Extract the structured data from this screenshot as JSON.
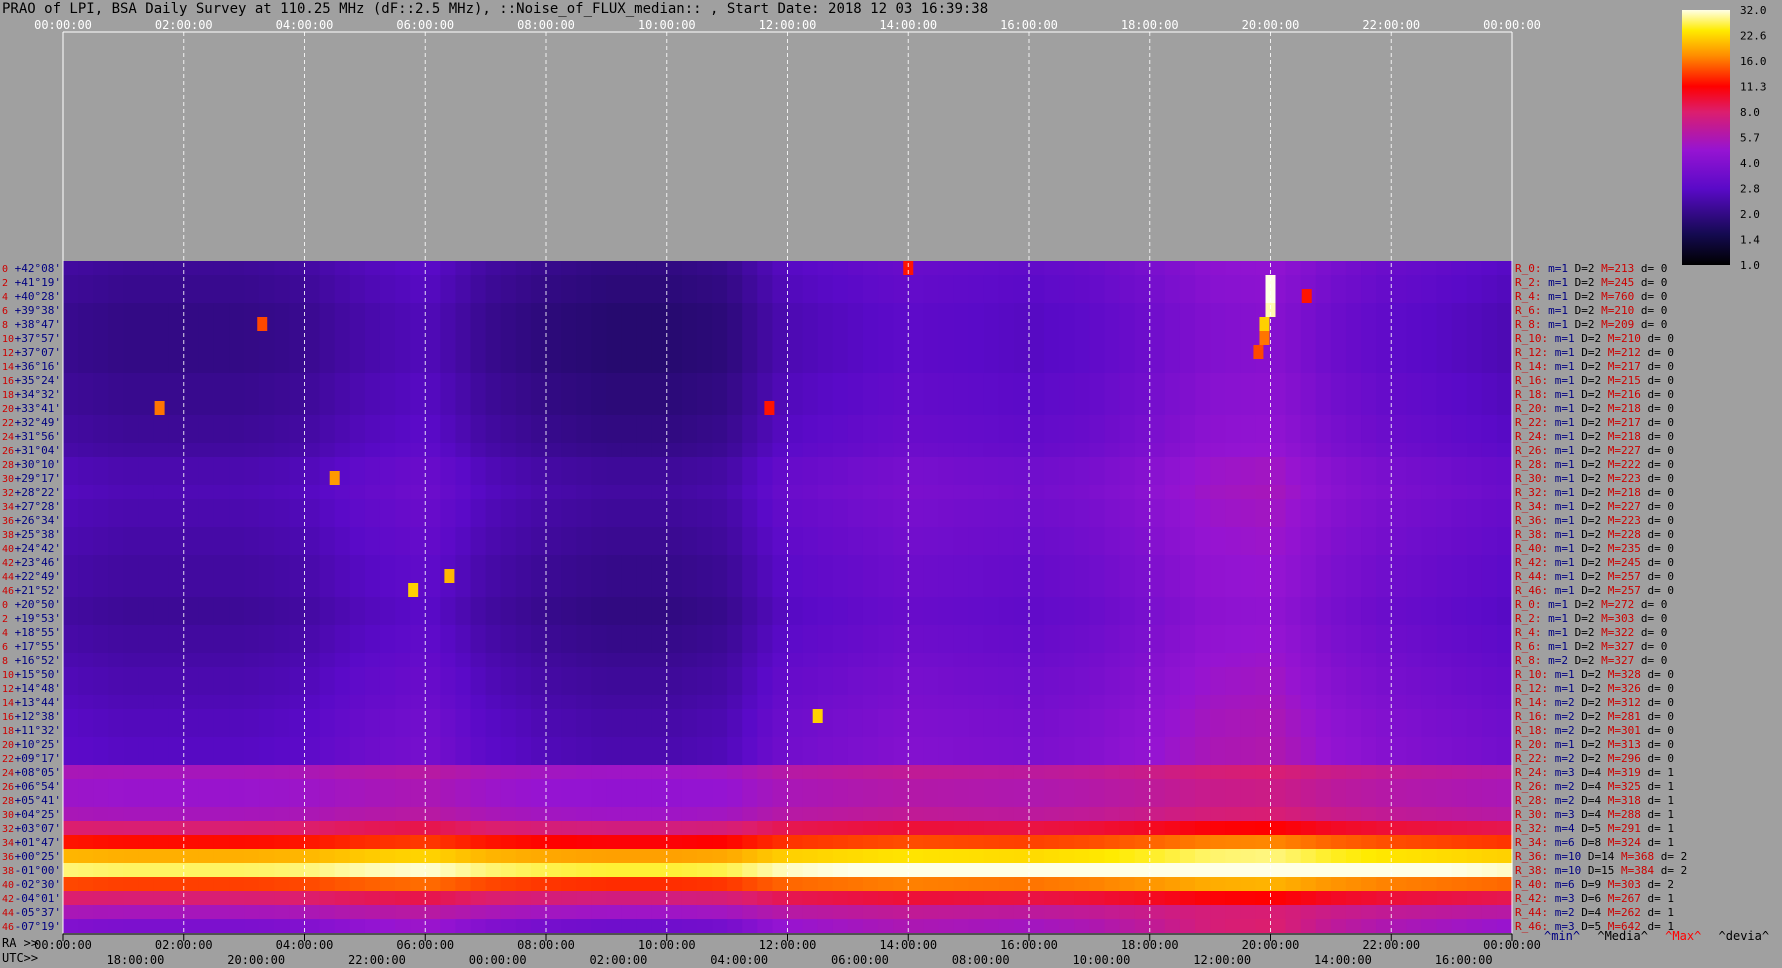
{
  "title": "PRAO of LPI, BSA Daily Survey at 110.25 MHz (dF::2.5 MHz), ::Noise_of_FLUX_median:: , Start Date: 2018 12 03 16:39:38",
  "colors": {
    "background": "#a0a0a0",
    "top_axis_text": "#ffffff",
    "row_index": "#cc0000",
    "dec_label": "#000080",
    "stat_red": "#cc0000",
    "stat_blue": "#000080"
  },
  "chart_data": {
    "type": "heatmap",
    "title": "PRAO of LPI, BSA Daily Survey at 110.25 MHz (dF::2.5 MHz), ::Noise_of_FLUX_median:: , Start Date: 2018 12 03 16:39:38",
    "top_time_ticks": [
      "00:00:00",
      "02:00:00",
      "04:00:00",
      "06:00:00",
      "08:00:00",
      "10:00:00",
      "12:00:00",
      "14:00:00",
      "16:00:00",
      "18:00:00",
      "20:00:00",
      "22:00:00",
      "00:00:00"
    ],
    "ra_label": "RA >>",
    "ra_ticks": [
      "00:00:00",
      "02:00:00",
      "04:00:00",
      "06:00:00",
      "08:00:00",
      "10:00:00",
      "12:00:00",
      "14:00:00",
      "16:00:00",
      "18:00:00",
      "20:00:00",
      "22:00:00",
      "00:00:00"
    ],
    "utc_label": "UTC>>",
    "utc_ticks": [
      "18:00:00",
      "20:00:00",
      "22:00:00",
      "00:00:00",
      "02:00:00",
      "04:00:00",
      "06:00:00",
      "08:00:00",
      "10:00:00",
      "12:00:00",
      "14:00:00",
      "16:00:00"
    ],
    "colorbar": {
      "ticks": [
        "32.0",
        "22.6",
        "16.0",
        "11.3",
        "8.0",
        "5.7",
        "4.0",
        "2.8",
        "2.0",
        "1.4",
        "1.0"
      ],
      "range": [
        1.0,
        32.0
      ],
      "scale": "log"
    },
    "row_indices": [
      "0",
      "2",
      "4",
      "6",
      "8",
      "10",
      "12",
      "14",
      "16",
      "18",
      "20",
      "22",
      "24",
      "26",
      "28",
      "30",
      "32",
      "34",
      "36",
      "38",
      "40",
      "42",
      "44",
      "46",
      "0",
      "2",
      "4",
      "6",
      "8",
      "10",
      "12",
      "14",
      "16",
      "18",
      "20",
      "22",
      "24",
      "26",
      "28",
      "30",
      "32",
      "34",
      "36",
      "38",
      "40",
      "42",
      "44",
      "46"
    ],
    "declinations": [
      "+42°08'",
      "+41°19'",
      "+40°28'",
      "+39°38'",
      "+38°47'",
      "+37°57'",
      "+37°07'",
      "+36°16'",
      "+35°24'",
      "+34°32'",
      "+33°41'",
      "+32°49'",
      "+31°56'",
      "+31°04'",
      "+30°10'",
      "+29°17'",
      "+28°22'",
      "+27°28'",
      "+26°34'",
      "+25°38'",
      "+24°42'",
      "+23°46'",
      "+22°49'",
      "+21°52'",
      "+20°50'",
      "+19°53'",
      "+18°55'",
      "+17°55'",
      "+16°52'",
      "+15°50'",
      "+14°48'",
      "+13°44'",
      "+12°38'",
      "+11°32'",
      "+10°25'",
      "+09°17'",
      "+08°05'",
      "+06°54'",
      "+05°41'",
      "+04°25'",
      "+03°07'",
      "+01°47'",
      "+00°25'",
      "-01°00'",
      "-02°30'",
      "-04°01'",
      "-05°37'",
      "-07°19'"
    ],
    "row_stats": [
      {
        "r": "R_0:",
        "m": "m=1",
        "D": "D=2",
        "M": "M=213",
        "d": "d= 0"
      },
      {
        "r": "R_2:",
        "m": "m=1",
        "D": "D=2",
        "M": "M=245",
        "d": "d= 0"
      },
      {
        "r": "R_4:",
        "m": "m=1",
        "D": "D=2",
        "M": "M=760",
        "d": "d= 0"
      },
      {
        "r": "R_6:",
        "m": "m=1",
        "D": "D=2",
        "M": "M=210",
        "d": "d= 0"
      },
      {
        "r": "R_8:",
        "m": "m=1",
        "D": "D=2",
        "M": "M=209",
        "d": "d= 0"
      },
      {
        "r": "R_10:",
        "m": "m=1",
        "D": "D=2",
        "M": "M=210",
        "d": "d= 0"
      },
      {
        "r": "R_12:",
        "m": "m=1",
        "D": "D=2",
        "M": "M=212",
        "d": "d= 0"
      },
      {
        "r": "R_14:",
        "m": "m=1",
        "D": "D=2",
        "M": "M=217",
        "d": "d= 0"
      },
      {
        "r": "R_16:",
        "m": "m=1",
        "D": "D=2",
        "M": "M=215",
        "d": "d= 0"
      },
      {
        "r": "R_18:",
        "m": "m=1",
        "D": "D=2",
        "M": "M=216",
        "d": "d= 0"
      },
      {
        "r": "R_20:",
        "m": "m=1",
        "D": "D=2",
        "M": "M=218",
        "d": "d= 0"
      },
      {
        "r": "R_22:",
        "m": "m=1",
        "D": "D=2",
        "M": "M=217",
        "d": "d= 0"
      },
      {
        "r": "R_24:",
        "m": "m=1",
        "D": "D=2",
        "M": "M=218",
        "d": "d= 0"
      },
      {
        "r": "R_26:",
        "m": "m=1",
        "D": "D=2",
        "M": "M=227",
        "d": "d= 0"
      },
      {
        "r": "R_28:",
        "m": "m=1",
        "D": "D=2",
        "M": "M=222",
        "d": "d= 0"
      },
      {
        "r": "R_30:",
        "m": "m=1",
        "D": "D=2",
        "M": "M=223",
        "d": "d= 0"
      },
      {
        "r": "R_32:",
        "m": "m=1",
        "D": "D=2",
        "M": "M=218",
        "d": "d= 0"
      },
      {
        "r": "R_34:",
        "m": "m=1",
        "D": "D=2",
        "M": "M=227",
        "d": "d= 0"
      },
      {
        "r": "R_36:",
        "m": "m=1",
        "D": "D=2",
        "M": "M=223",
        "d": "d= 0"
      },
      {
        "r": "R_38:",
        "m": "m=1",
        "D": "D=2",
        "M": "M=228",
        "d": "d= 0"
      },
      {
        "r": "R_40:",
        "m": "m=1",
        "D": "D=2",
        "M": "M=235",
        "d": "d= 0"
      },
      {
        "r": "R_42:",
        "m": "m=1",
        "D": "D=2",
        "M": "M=245",
        "d": "d= 0"
      },
      {
        "r": "R_44:",
        "m": "m=1",
        "D": "D=2",
        "M": "M=257",
        "d": "d= 0"
      },
      {
        "r": "R_46:",
        "m": "m=1",
        "D": "D=2",
        "M": "M=257",
        "d": "d= 0"
      },
      {
        "r": "R_0:",
        "m": "m=1",
        "D": "D=2",
        "M": "M=272",
        "d": "d= 0"
      },
      {
        "r": "R_2:",
        "m": "m=1",
        "D": "D=2",
        "M": "M=303",
        "d": "d= 0"
      },
      {
        "r": "R_4:",
        "m": "m=1",
        "D": "D=2",
        "M": "M=322",
        "d": "d= 0"
      },
      {
        "r": "R_6:",
        "m": "m=1",
        "D": "D=2",
        "M": "M=327",
        "d": "d= 0"
      },
      {
        "r": "R_8:",
        "m": "m=2",
        "D": "D=2",
        "M": "M=327",
        "d": "d= 0"
      },
      {
        "r": "R_10:",
        "m": "m=1",
        "D": "D=2",
        "M": "M=328",
        "d": "d= 0"
      },
      {
        "r": "R_12:",
        "m": "m=1",
        "D": "D=2",
        "M": "M=326",
        "d": "d= 0"
      },
      {
        "r": "R_14:",
        "m": "m=2",
        "D": "D=2",
        "M": "M=312",
        "d": "d= 0"
      },
      {
        "r": "R_16:",
        "m": "m=2",
        "D": "D=2",
        "M": "M=281",
        "d": "d= 0"
      },
      {
        "r": "R_18:",
        "m": "m=2",
        "D": "D=2",
        "M": "M=301",
        "d": "d= 0"
      },
      {
        "r": "R_20:",
        "m": "m=1",
        "D": "D=2",
        "M": "M=313",
        "d": "d= 0"
      },
      {
        "r": "R_22:",
        "m": "m=2",
        "D": "D=2",
        "M": "M=296",
        "d": "d= 0"
      },
      {
        "r": "R_24:",
        "m": "m=3",
        "D": "D=4",
        "M": "M=319",
        "d": "d= 1"
      },
      {
        "r": "R_26:",
        "m": "m=2",
        "D": "D=4",
        "M": "M=325",
        "d": "d= 1"
      },
      {
        "r": "R_28:",
        "m": "m=2",
        "D": "D=4",
        "M": "M=318",
        "d": "d= 1"
      },
      {
        "r": "R_30:",
        "m": "m=3",
        "D": "D=4",
        "M": "M=288",
        "d": "d= 1"
      },
      {
        "r": "R_32:",
        "m": "m=4",
        "D": "D=5",
        "M": "M=291",
        "d": "d= 1"
      },
      {
        "r": "R_34:",
        "m": "m=6",
        "D": "D=8",
        "M": "M=324",
        "d": "d= 1"
      },
      {
        "r": "R_36:",
        "m": "m=10",
        "D": "D=14",
        "M": "M=368",
        "d": "d= 2"
      },
      {
        "r": "R_38:",
        "m": "m=10",
        "D": "D=15",
        "M": "M=384",
        "d": "d= 2"
      },
      {
        "r": "R_40:",
        "m": "m=6",
        "D": "D=9",
        "M": "M=303",
        "d": "d= 2"
      },
      {
        "r": "R_42:",
        "m": "m=3",
        "D": "D=6",
        "M": "M=267",
        "d": "d= 1"
      },
      {
        "r": "R_44:",
        "m": "m=2",
        "D": "D=4",
        "M": "M=262",
        "d": "d= 1"
      },
      {
        "r": "R_46:",
        "m": "m=3",
        "D": "D=5",
        "M": "M=642",
        "d": "d= 1"
      }
    ],
    "stat_legend": {
      "min": "^min^",
      "median": "^Media^",
      "max": "^Max^",
      "dev": "^devia^"
    },
    "row_levels": [
      2.3,
      2.2,
      2.2,
      2.1,
      2.1,
      2.1,
      2.1,
      2.1,
      2.2,
      2.2,
      2.2,
      2.3,
      2.3,
      2.4,
      2.6,
      2.6,
      2.7,
      2.6,
      2.6,
      2.5,
      2.5,
      2.4,
      2.4,
      2.4,
      2.3,
      2.3,
      2.4,
      2.4,
      2.5,
      2.6,
      2.6,
      2.7,
      2.8,
      2.8,
      2.9,
      2.9,
      5.5,
      5.0,
      5.0,
      5.5,
      8.0,
      12.0,
      20.0,
      28.0,
      14.0,
      8.0,
      5.5,
      4.0
    ],
    "time_profile": {
      "hours": [
        0,
        1,
        2,
        3,
        4,
        5,
        6,
        7,
        8,
        9,
        10,
        11,
        12,
        13,
        14,
        15,
        16,
        17,
        18,
        19,
        20,
        21,
        22,
        23,
        24
      ],
      "factor": [
        1.0,
        0.95,
        0.95,
        0.95,
        1.0,
        1.15,
        1.25,
        1.0,
        0.9,
        0.85,
        0.85,
        0.9,
        1.2,
        1.3,
        1.4,
        1.35,
        1.3,
        1.4,
        1.6,
        1.9,
        2.0,
        1.6,
        1.4,
        1.3,
        1.2
      ]
    },
    "hotspots": [
      {
        "hour": 20.0,
        "dec": "+40°28'",
        "value": 32.0
      },
      {
        "hour": 20.0,
        "dec": "+41°19'",
        "value": 32.0
      },
      {
        "hour": 20.0,
        "dec": "+39°38'",
        "value": 30.0
      },
      {
        "hour": 19.9,
        "dec": "+38°47'",
        "value": 22.0
      },
      {
        "hour": 19.9,
        "dec": "+37°57'",
        "value": 16.0
      },
      {
        "hour": 19.8,
        "dec": "+37°07'",
        "value": 14.0
      },
      {
        "hour": 5.8,
        "dec": "+21°52'",
        "value": 22.0
      },
      {
        "hour": 6.4,
        "dec": "+22°49'",
        "value": 20.0
      },
      {
        "hour": 12.5,
        "dec": "+12°38'",
        "value": 22.0
      },
      {
        "hour": 4.5,
        "dec": "+29°17'",
        "value": 18.0
      },
      {
        "hour": 1.6,
        "dec": "+33°41'",
        "value": 16.0
      },
      {
        "hour": 3.3,
        "dec": "+38°47'",
        "value": 14.0
      },
      {
        "hour": 11.7,
        "dec": "+33°41'",
        "value": 12.0
      },
      {
        "hour": 14.0,
        "dec": "+42°08'",
        "value": 12.0
      },
      {
        "hour": 20.6,
        "dec": "+40°28'",
        "value": 12.0
      }
    ]
  }
}
